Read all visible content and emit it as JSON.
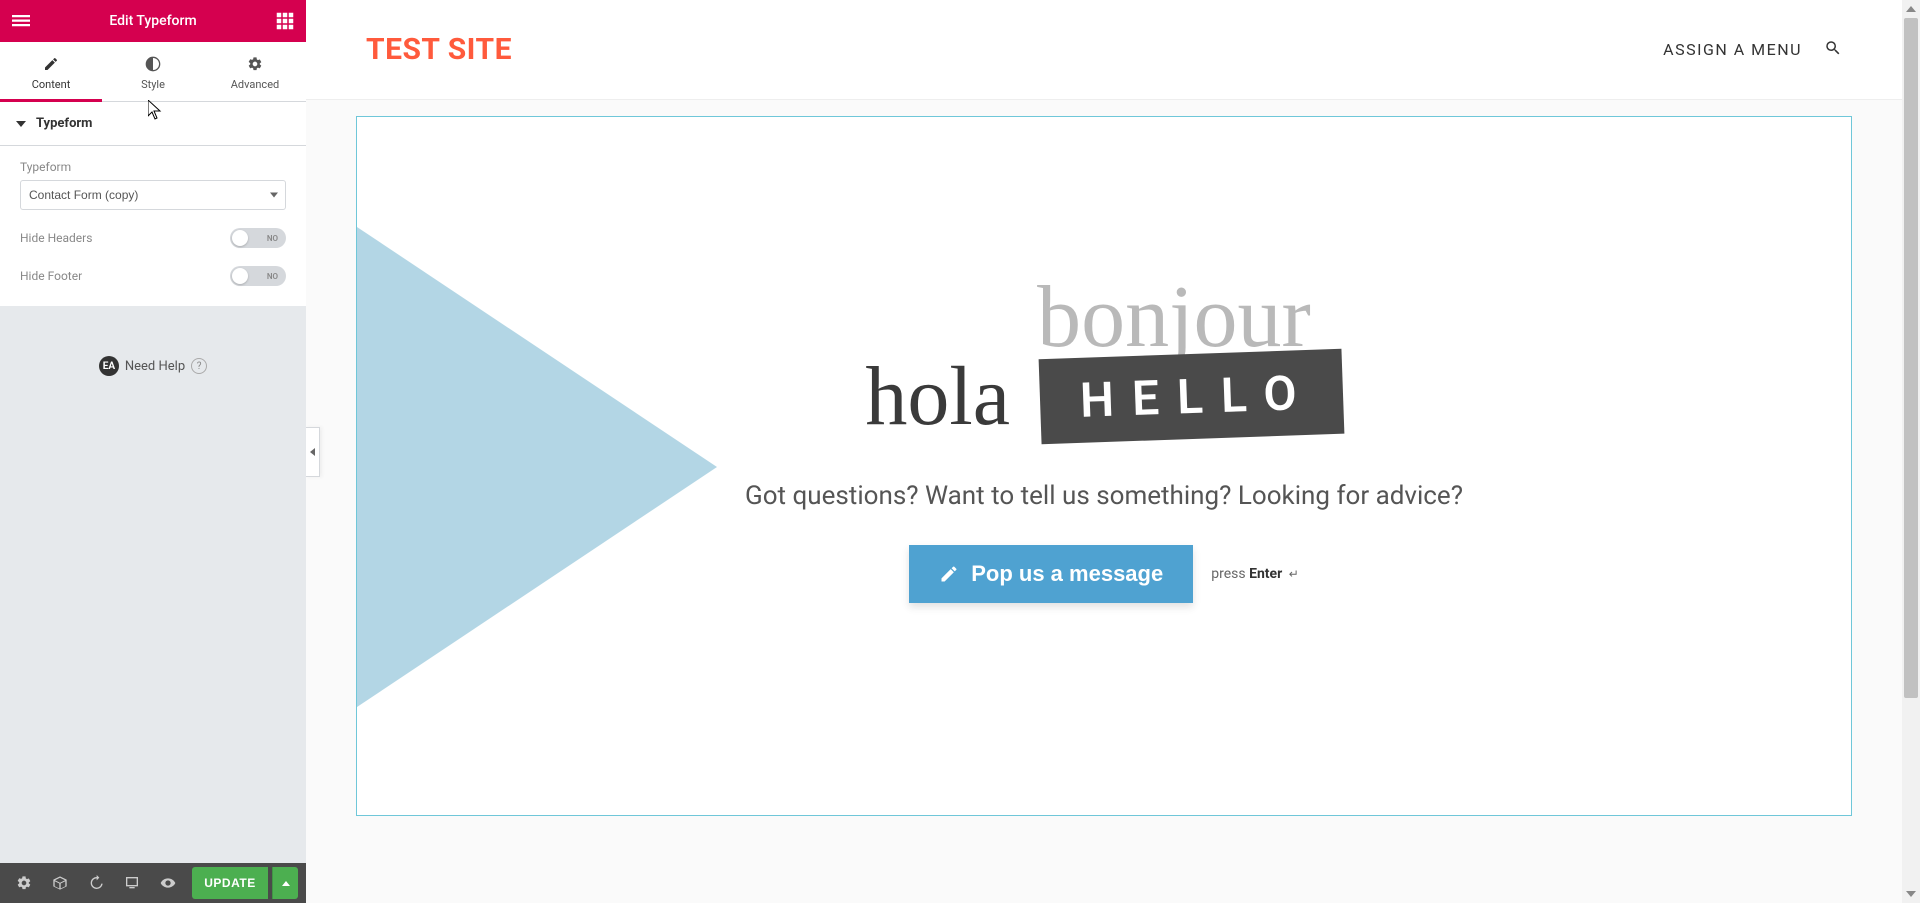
{
  "sidebar": {
    "header_title": "Edit Typeform",
    "tabs": {
      "content": "Content",
      "style": "Style",
      "advanced": "Advanced"
    },
    "section_title": "Typeform",
    "controls": {
      "typeform_label": "Typeform",
      "typeform_selected": "Contact Form (copy)",
      "hide_headers_label": "Hide Headers",
      "hide_headers_value": "NO",
      "hide_footer_label": "Hide Footer",
      "hide_footer_value": "NO"
    },
    "help": {
      "badge": "EA",
      "text": "Need Help",
      "q": "?"
    },
    "footer": {
      "update": "UPDATE"
    }
  },
  "main": {
    "site_title": "TEST SITE",
    "nav_link": "ASSIGN A MENU",
    "hero": {
      "bonjour": "bonjour",
      "hola": "hola",
      "hello": "HELLO",
      "subtitle": "Got questions? Want to tell us something? Looking for advice?",
      "cta": "Pop us a message",
      "press": "press",
      "enter": "Enter",
      "enter_glyph": "↵"
    }
  }
}
